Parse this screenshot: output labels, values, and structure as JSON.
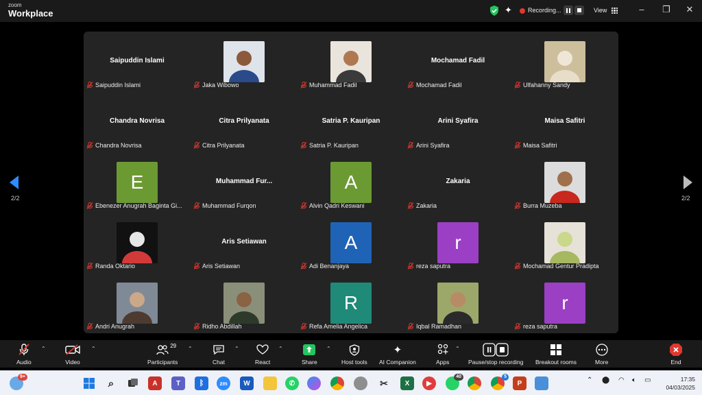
{
  "app": {
    "brand_small": "zoom",
    "brand_name": "Workplace"
  },
  "titlebar": {
    "recording_label": "Recording...",
    "view_label": "View"
  },
  "pager": {
    "left": "2/2",
    "right": "2/2"
  },
  "participants_grid": [
    {
      "name": "Saipuddin Islami",
      "display": "Saipuddin Islami",
      "avatar": "name",
      "muted": true
    },
    {
      "name": "Jaka Wibowo",
      "avatar": "photo-jaka",
      "muted": true
    },
    {
      "name": "Muhammad Fadil",
      "avatar": "photo-fadil",
      "muted": true
    },
    {
      "name": "Mochamad Fadil",
      "display": "Mochamad Fadil",
      "avatar": "name",
      "muted": true
    },
    {
      "name": "Ulfahanny Sandy",
      "avatar": "photo-ulfa",
      "muted": true
    },
    {
      "name": "Chandra Novrisa",
      "display": "Chandra Novrisa",
      "avatar": "name",
      "muted": true
    },
    {
      "name": "Citra Prilyanata",
      "display": "Citra Prilyanata",
      "avatar": "name",
      "muted": true
    },
    {
      "name": "Satria P. Kauripan",
      "display": "Satria P. Kauripan",
      "avatar": "name",
      "muted": true
    },
    {
      "name": "Arini Syafira",
      "display": "Arini Syafira",
      "avatar": "name",
      "muted": true
    },
    {
      "name": "Maisa Safitri",
      "display": "Maisa Safitri",
      "avatar": "name",
      "muted": true
    },
    {
      "name": "Ebenezer Anugrah Baginta Gi...",
      "avatar": "letter",
      "letter": "E",
      "color": "#6b9a33",
      "muted": true
    },
    {
      "name": "Muhammad Furqon",
      "display": "Muhammad Fur...",
      "avatar": "name",
      "muted": true
    },
    {
      "name": "Alvin Qadri Keswani",
      "avatar": "letter",
      "letter": "A",
      "color": "#6b9a33",
      "muted": true
    },
    {
      "name": "Zakaria",
      "display": "Zakaria",
      "avatar": "name",
      "muted": true
    },
    {
      "name": "Burra Muzeba",
      "avatar": "photo-burra",
      "muted": true
    },
    {
      "name": "Randa Oktario",
      "avatar": "photo-randa",
      "muted": true
    },
    {
      "name": "Aris Setiawan",
      "display": "Aris Setiawan",
      "avatar": "name",
      "muted": true
    },
    {
      "name": "Adi Benanjaya",
      "avatar": "letter",
      "letter": "A",
      "color": "#1f63b6",
      "muted": true
    },
    {
      "name": "reza saputra",
      "avatar": "letter",
      "letter": "r",
      "color": "#9b3fc4",
      "muted": true
    },
    {
      "name": "Mochamad Gentur Pradipta",
      "avatar": "photo-gentur",
      "muted": true
    },
    {
      "name": "Andri Anugrah",
      "avatar": "photo-andri",
      "muted": true
    },
    {
      "name": "Ridho Abdillah",
      "avatar": "photo-ridho",
      "muted": true
    },
    {
      "name": "Refa Amelia Angelica",
      "avatar": "letter",
      "letter": "R",
      "color": "#1f8a78",
      "muted": true
    },
    {
      "name": "Iqbal Ramadhan",
      "avatar": "photo-iqbal",
      "muted": true
    },
    {
      "name": "reza saputra",
      "avatar": "letter",
      "letter": "r",
      "color": "#9b3fc4",
      "muted": true
    }
  ],
  "toolbar": {
    "audio": "Audio",
    "video": "Video",
    "participants": "Participants",
    "participants_count": "29",
    "chat": "Chat",
    "react": "React",
    "share": "Share",
    "host_tools": "Host tools",
    "ai_companion": "AI Companion",
    "apps": "Apps",
    "pause_stop": "Pause/stop recording",
    "breakout": "Breakout rooms",
    "more": "More",
    "end": "End"
  },
  "taskbar": {
    "weather_badge": "9+",
    "zoom_label": "zm",
    "word_label": "W",
    "excel_label": "X",
    "ppt_label": "P",
    "whatsapp_badge": "40",
    "chrome_badge": "5",
    "time": "17:35",
    "date": "04/03/2025"
  },
  "colors": {
    "accent_green": "#23c55e",
    "record_red": "#e0382f",
    "end_red": "#e0382f"
  }
}
